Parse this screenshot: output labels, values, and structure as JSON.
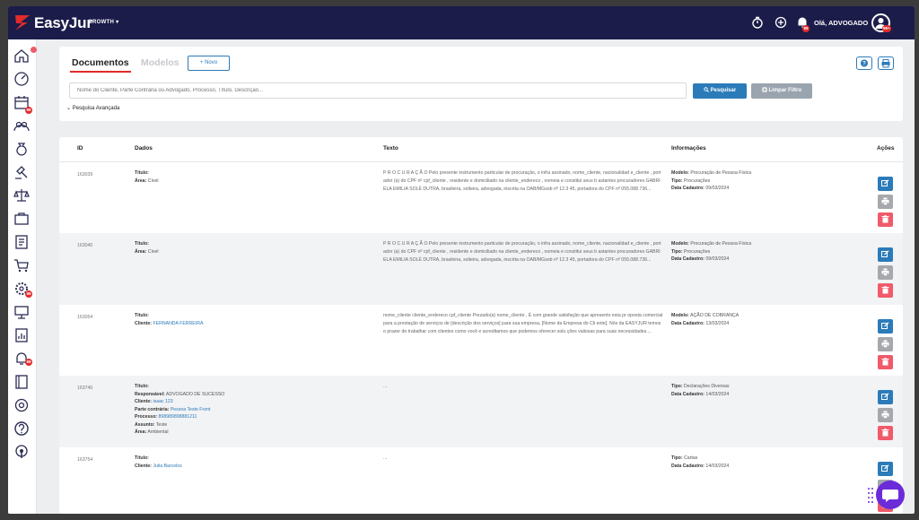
{
  "app": {
    "logo_text": "EasyJur",
    "plan": "GROWTH",
    "greeting": "Olá, ADVOGADO",
    "notif_badge": "99",
    "avatar_badge": "99+"
  },
  "colors": {
    "topbar": "#1b1c49",
    "primary": "#2b7bb9",
    "danger": "#f05a6a",
    "brand_red": "#e12b2b",
    "chat": "#6c2bd9"
  },
  "sidebar": {
    "items": [
      {
        "icon": "home-icon"
      },
      {
        "icon": "dashboard-icon"
      },
      {
        "icon": "calendar-icon",
        "badge": "99"
      },
      {
        "icon": "users-icon"
      },
      {
        "icon": "money-bag-icon"
      },
      {
        "icon": "gavel-icon"
      },
      {
        "icon": "scales-icon"
      },
      {
        "icon": "briefcase-icon"
      },
      {
        "icon": "documents-icon"
      },
      {
        "icon": "cart-icon"
      },
      {
        "icon": "settings-gear-icon",
        "badge": "99"
      },
      {
        "icon": "presentation-icon"
      },
      {
        "icon": "report-icon"
      },
      {
        "icon": "bell-icon",
        "badge": "99"
      },
      {
        "icon": "book-icon"
      },
      {
        "icon": "gear-icon"
      },
      {
        "icon": "help-icon"
      },
      {
        "icon": "broadcast-icon"
      }
    ]
  },
  "search": {
    "tabs": [
      "Documentos",
      "Modelos"
    ],
    "new_label": "+ Novo",
    "placeholder": "Nome do Cliente, Parte Contrária ou Advogado, Processo, Título, Descrição...",
    "search_label": "Pesquisar",
    "clear_label": "Limpar Filtro",
    "advanced_label": "Pesquisa Avançada"
  },
  "table": {
    "headers": {
      "id": "ID",
      "dados": "Dados",
      "texto": "Texto",
      "info": "Informações",
      "acoes": "Ações"
    },
    "rows": [
      {
        "id": "163039",
        "dados": [
          {
            "k": "Título:",
            "v": ""
          },
          {
            "k": "Área:",
            "v": "Cível"
          }
        ],
        "texto": "P R O C U R A Ç Ã O  Pelo presente instrumento particular de procuração, o infra assinado, nome_cliente,  nacionalidad e_cliente , portador (a) do CPF nº  cpf_cliente , residente e domiciliado na  cliente_endereco , nomeia e constitui seus b astantes procuradores  GABRIELA EMILIA SOLÉ DUTRA, brasileira, solteira, advogada, inscrita na OAB/MGsob nº 12.3 45, portadora do CPF nº 055.088.736...",
        "info": [
          {
            "k": "Modelo:",
            "v": "Procuração de Pessoa Física"
          },
          {
            "k": "Tipo:",
            "v": "Procurações"
          },
          {
            "k": "Data Cadastro:",
            "v": "09/03/2024"
          }
        ]
      },
      {
        "id": "163040",
        "dados": [
          {
            "k": "Título:",
            "v": ""
          },
          {
            "k": "Área:",
            "v": "Cível"
          }
        ],
        "texto": "P R O C U R A Ç Ã O  Pelo presente instrumento particular de procuração, o infra assinado, nome_cliente,  nacionalidad e_cliente , portador (a) do CPF nº  cpf_cliente , residente e domiciliado na  cliente_endereco , nomeia e constitui seus b astantes procuradores  GABRIELA EMILIA SOLÉ DUTRA, brasileira, solteira, advogada, inscrita na OAB/MGsob nº 12.3 45, portadora do CPF nº 055.088.736...",
        "info": [
          {
            "k": "Modelo:",
            "v": "Procuração de Pessoa Física"
          },
          {
            "k": "Tipo:",
            "v": "Procurações"
          },
          {
            "k": "Data Cadastro:",
            "v": "09/03/2024"
          }
        ]
      },
      {
        "id": "163054",
        "dados": [
          {
            "k": "Título:",
            "v": ""
          },
          {
            "k": "Cliente:",
            "v": "FERNANDA FERREIRA",
            "link": true
          }
        ],
        "texto": "nome_cliente  cliente_endereco  cpf_cliente  Prezado(a)  nome_cliente , É com grande satisfação que apresento esta pr oposta comercial para a prestação de serviços de [descrição dos serviços] para sua empresa, [Nome da Empresa do Cli ente]. Nós da EASYJUR temos o prazer de trabalhar com clientes como você e acreditamos que podemos oferecer solu ções valiosas para suas necessidades....",
        "info": [
          {
            "k": "Modelo:",
            "v": "AÇÃO DE COBRANÇA"
          },
          {
            "k": "Data Cadastro:",
            "v": "13/03/2024"
          }
        ]
      },
      {
        "id": "163740",
        "dados": [
          {
            "k": "Título:",
            "v": ""
          },
          {
            "k": "Responsável:",
            "v": "ADVOGADO DE SUCESSO"
          },
          {
            "k": "Cliente:",
            "v": "isaac 123",
            "link": true
          },
          {
            "k": "Parte contrária:",
            "v": "Pessoa Teste Front",
            "link": true
          },
          {
            "k": "Processo:",
            "v": "898989898881211",
            "link": true
          },
          {
            "k": "Assunto:",
            "v": "Teste"
          },
          {
            "k": "Área:",
            "v": "Ambiental"
          }
        ],
        "texto": "...",
        "info": [
          {
            "k": "Tipo:",
            "v": "Declarações Diversas"
          },
          {
            "k": "Data Cadastro:",
            "v": "14/03/2024"
          }
        ]
      },
      {
        "id": "163754",
        "dados": [
          {
            "k": "Título:",
            "v": ""
          },
          {
            "k": "Cliente:",
            "v": "Julia Barcelos",
            "link": true
          }
        ],
        "texto": "...",
        "info": [
          {
            "k": "Tipo:",
            "v": "Cartas"
          },
          {
            "k": "Data Cadastro:",
            "v": "14/03/2024"
          }
        ]
      }
    ]
  }
}
